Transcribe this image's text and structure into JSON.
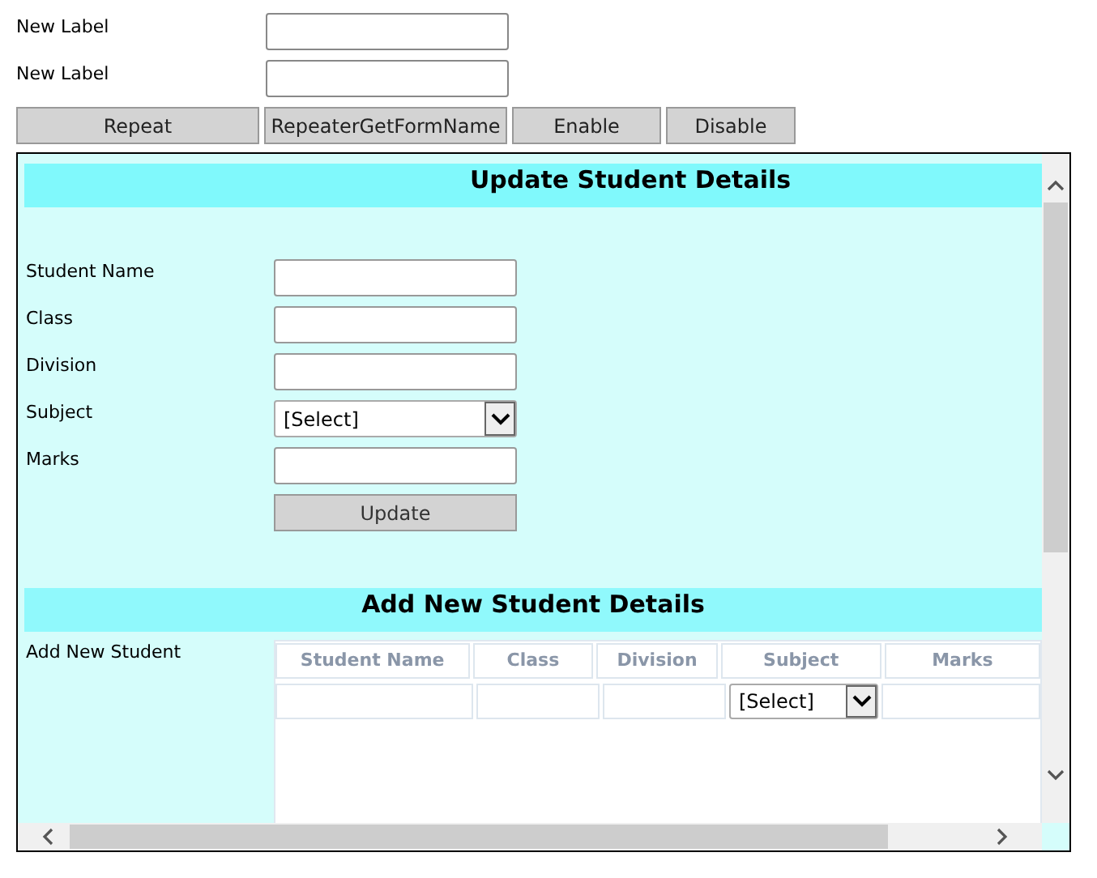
{
  "top_fields": [
    {
      "label": "New Label"
    },
    {
      "label": "New Label"
    }
  ],
  "buttons": [
    "Repeat",
    "RepeaterGetFormName",
    "Enable",
    "Disable"
  ],
  "update_section": {
    "title": "Update Student Details",
    "fields": [
      {
        "label": "Student Name",
        "kind": "text"
      },
      {
        "label": "Class",
        "kind": "text"
      },
      {
        "label": "Division",
        "kind": "text"
      },
      {
        "label": "Subject",
        "kind": "select",
        "value": "[Select]"
      },
      {
        "label": "Marks",
        "kind": "text"
      }
    ],
    "button": "Update"
  },
  "add_section": {
    "title": "Add New Student Details",
    "label": "Add New Student",
    "columns": [
      "Student Name",
      "Class",
      "Division",
      "Subject",
      "Marks"
    ],
    "row": [
      {
        "kind": "text"
      },
      {
        "kind": "text"
      },
      {
        "kind": "text"
      },
      {
        "kind": "select",
        "value": "[Select]"
      },
      {
        "kind": "text"
      }
    ]
  }
}
